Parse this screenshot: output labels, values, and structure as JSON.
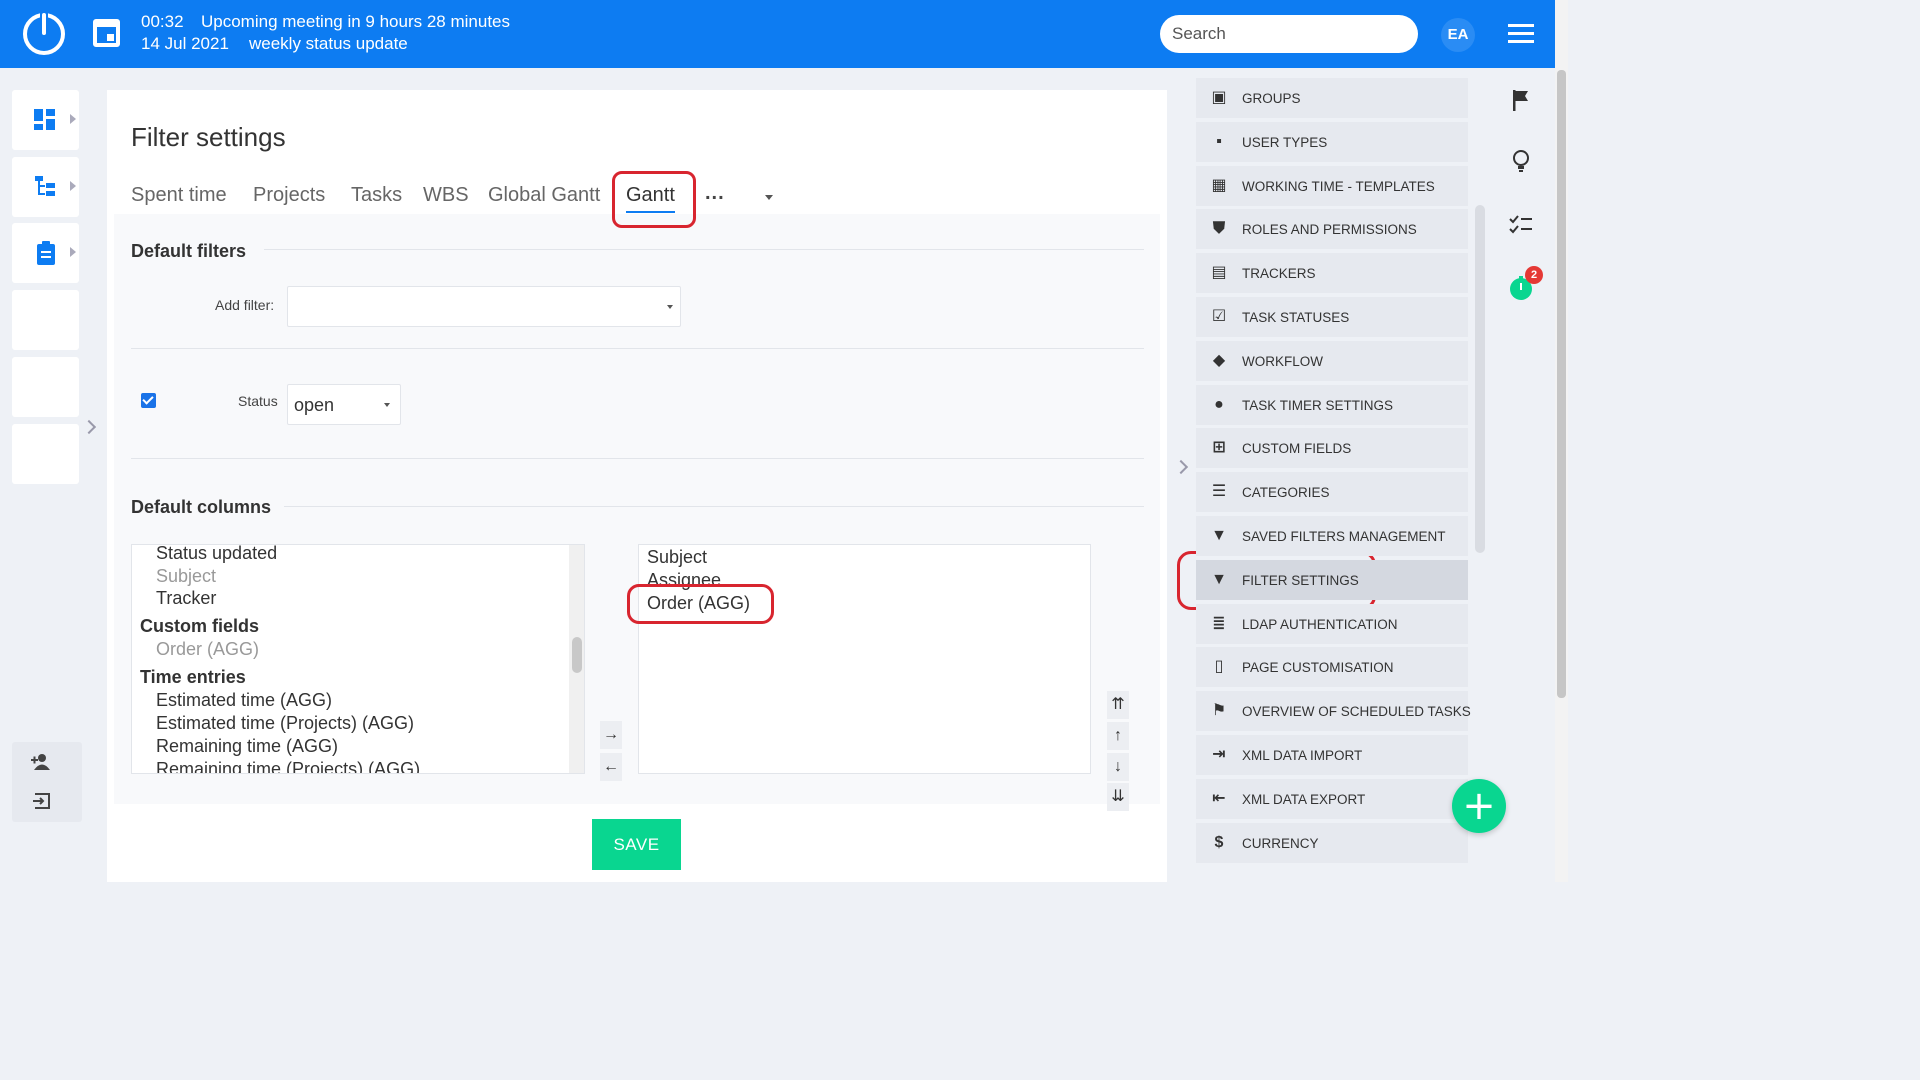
{
  "topbar": {
    "time": "00:32",
    "meeting": "Upcoming meeting in 9 hours 28 minutes",
    "date": "14 Jul 2021",
    "meeting_name": "weekly status update",
    "search_placeholder": "Search",
    "avatar_initials": "EA"
  },
  "page": {
    "title": "Filter settings",
    "tabs": [
      "Spent time",
      "Projects",
      "Tasks",
      "WBS",
      "Global Gantt",
      "Gantt"
    ],
    "active_tab": "Gantt",
    "more_label": "..."
  },
  "default_filters": {
    "title": "Default filters",
    "add_filter_label": "Add filter:",
    "add_filter_value": "",
    "status_label": "Status",
    "status_value": "open",
    "status_checked": true
  },
  "default_columns": {
    "title": "Default columns",
    "available": [
      {
        "text": "Status updated",
        "kind": "item"
      },
      {
        "text": "Subject",
        "kind": "disabled"
      },
      {
        "text": "Tracker",
        "kind": "item"
      },
      {
        "text": "Custom fields",
        "kind": "group"
      },
      {
        "text": "Order (AGG)",
        "kind": "disabled"
      },
      {
        "text": "Time entries",
        "kind": "group"
      },
      {
        "text": "Estimated time (AGG)",
        "kind": "item"
      },
      {
        "text": "Estimated time (Projects) (AGG)",
        "kind": "item"
      },
      {
        "text": "Remaining time (AGG)",
        "kind": "item"
      },
      {
        "text": "Remaining time (Projects) (AGG)",
        "kind": "item"
      }
    ],
    "selected": [
      "Subject",
      "Assignee",
      "Order (AGG)"
    ],
    "move_buttons": [
      "→",
      "←"
    ],
    "order_buttons": [
      "⇈",
      "↑",
      "↓",
      "⇊"
    ]
  },
  "save_label": "SAVE",
  "right_menu": [
    {
      "icon": "groups-icon",
      "glyph": "▣",
      "label": "GROUPS"
    },
    {
      "icon": "user-types-icon",
      "glyph": "▪",
      "label": "USER TYPES"
    },
    {
      "icon": "calendar-icon",
      "glyph": "▦",
      "label": "WORKING TIME - TEMPLATES"
    },
    {
      "icon": "shield-icon",
      "glyph": "⛊",
      "label": "ROLES AND PERMISSIONS"
    },
    {
      "icon": "clipboard-icon",
      "glyph": "▤",
      "label": "TRACKERS"
    },
    {
      "icon": "checkbox-icon",
      "glyph": "☑",
      "label": "TASK STATUSES"
    },
    {
      "icon": "workflow-icon",
      "glyph": "◆",
      "label": "WORKFLOW"
    },
    {
      "icon": "stopwatch-icon",
      "glyph": "●",
      "label": "TASK TIMER SETTINGS"
    },
    {
      "icon": "plus-square-icon",
      "glyph": "⊞",
      "label": "CUSTOM FIELDS"
    },
    {
      "icon": "list-icon",
      "glyph": "☰",
      "label": "CATEGORIES"
    },
    {
      "icon": "filter-icon",
      "glyph": "▼",
      "label": "SAVED FILTERS MANAGEMENT"
    },
    {
      "icon": "filter-icon",
      "glyph": "▼",
      "label": "FILTER SETTINGS"
    },
    {
      "icon": "server-icon",
      "glyph": "≣",
      "label": "LDAP AUTHENTICATION"
    },
    {
      "icon": "file-icon",
      "glyph": "▯",
      "label": "PAGE CUSTOMISATION"
    },
    {
      "icon": "flag-icon",
      "glyph": "⚑",
      "label": "OVERVIEW OF SCHEDULED TASKS"
    },
    {
      "icon": "import-icon",
      "glyph": "⇥",
      "label": "XML DATA IMPORT"
    },
    {
      "icon": "export-icon",
      "glyph": "⇤",
      "label": "XML DATA EXPORT"
    },
    {
      "icon": "currency-icon",
      "glyph": "$",
      "label": "CURRENCY"
    }
  ],
  "right_menu_active": "FILTER SETTINGS",
  "timer_badge": "2",
  "fab_label": "+",
  "colors": {
    "brand": "#0d7cf2",
    "accent": "#09d690",
    "annotation": "#d8252f"
  }
}
